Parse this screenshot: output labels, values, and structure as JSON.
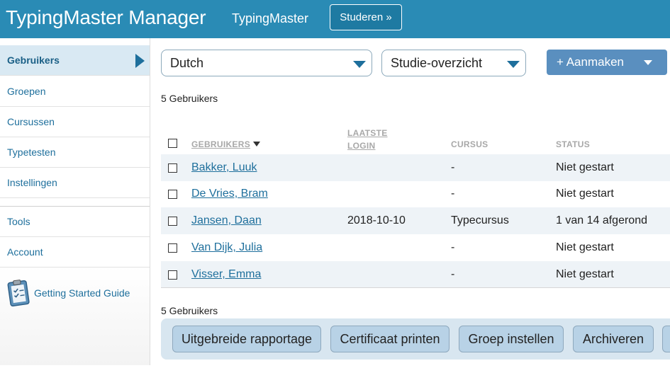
{
  "header": {
    "title": "TypingMaster Manager",
    "nav_link": "TypingMaster",
    "study_button": "Studeren »",
    "bg_color": "#2a8bb5"
  },
  "sidebar": {
    "items": [
      {
        "label": "Gebruikers",
        "active": true
      },
      {
        "label": "Groepen"
      },
      {
        "label": "Cursussen"
      },
      {
        "label": "Typetesten"
      },
      {
        "label": "Instellingen"
      },
      {
        "label": "Tools"
      },
      {
        "label": "Account"
      }
    ],
    "guide": {
      "label": "Getting Started Guide",
      "icon": "clipboard-checklist-icon"
    }
  },
  "toolbar": {
    "language_select": "Dutch",
    "view_select": "Studie-overzicht",
    "create_button": "+ Aanmaken"
  },
  "summary": {
    "top": "5 Gebruikers",
    "bottom": "5 Gebruikers"
  },
  "table": {
    "headers": {
      "users": "GEBRUIKERS",
      "last_login_1": "LAATSTE",
      "last_login_2": "LOGIN",
      "course": "CURSUS",
      "status": "STATUS"
    },
    "rows": [
      {
        "name": "Bakker, Luuk",
        "last_login": "",
        "course": "-",
        "status": "Niet gestart"
      },
      {
        "name": "De Vries, Bram",
        "last_login": "",
        "course": "-",
        "status": "Niet gestart"
      },
      {
        "name": "Jansen, Daan",
        "last_login": "2018-10-10",
        "course": "Typecursus",
        "status": "1 van 14 afgerond"
      },
      {
        "name": "Van Dijk, Julia",
        "last_login": "",
        "course": "-",
        "status": "Niet gestart"
      },
      {
        "name": "Visser, Emma",
        "last_login": "",
        "course": "-",
        "status": "Niet gestart"
      }
    ]
  },
  "actions": {
    "report": "Uitgebreide rapportage",
    "certificate": "Certificaat printen",
    "group": "Groep instellen",
    "archive": "Archiveren"
  }
}
